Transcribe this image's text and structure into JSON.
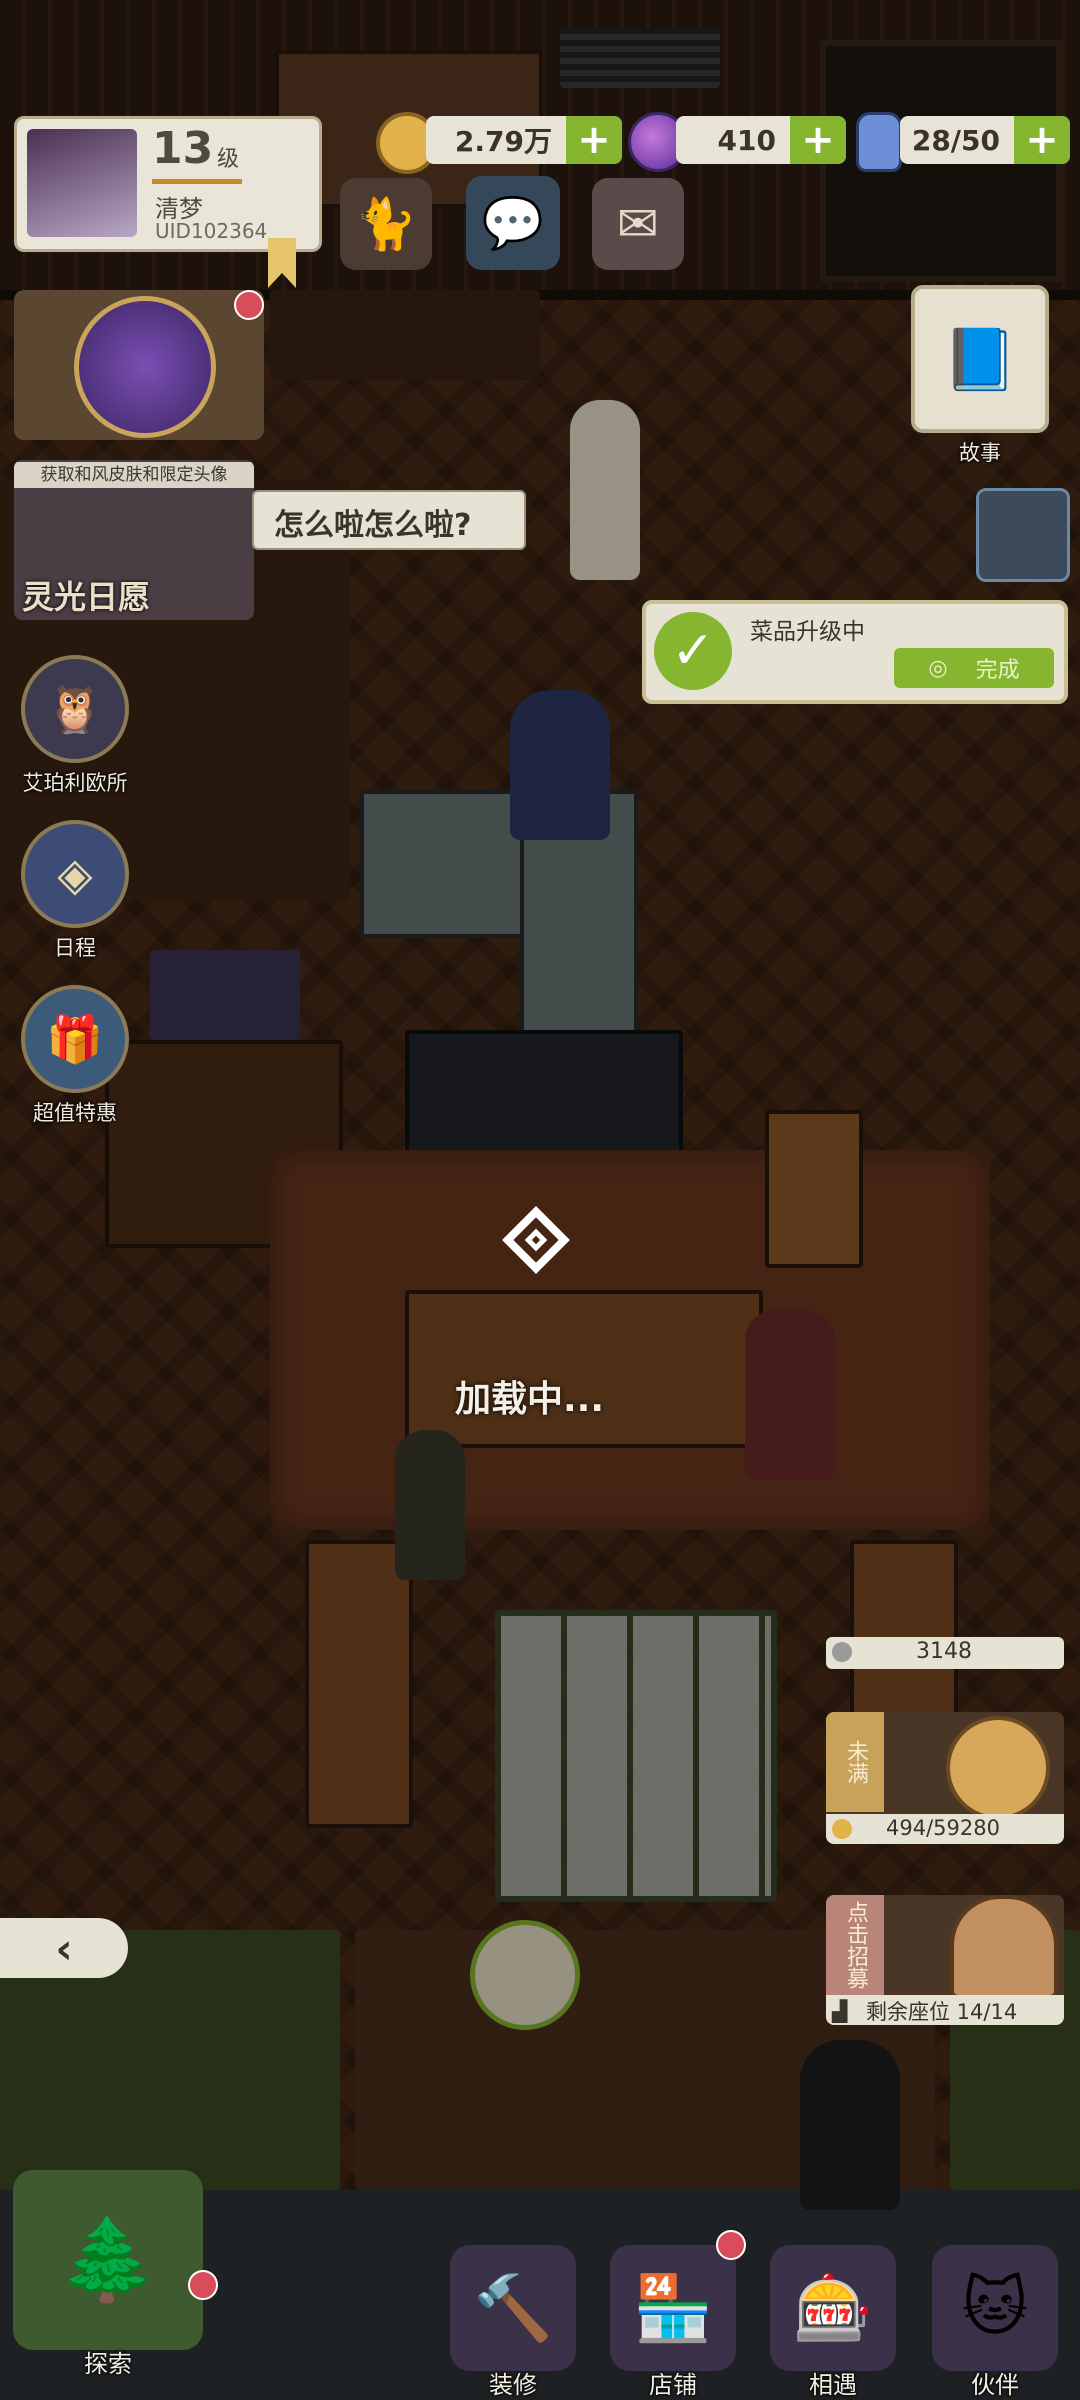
{
  "player": {
    "level_num": "13",
    "level_suffix": "级",
    "name": "清梦",
    "uid": "UID102364"
  },
  "resources": {
    "coins": "2.79万",
    "gems": "410",
    "stamina": "28/50"
  },
  "promo": {
    "banner_text": "获取和风皮肤和限定头像",
    "banner_title": "灵光日愿"
  },
  "speech": {
    "text": "怎么啦怎么啦?"
  },
  "side_menu": {
    "office": "艾珀利欧所",
    "schedule": "日程",
    "deals": "超值特惠",
    "story": "故事"
  },
  "task": {
    "title": "菜品升级中",
    "button": "完成"
  },
  "loading": {
    "text": "加载中..."
  },
  "stats": {
    "popularity": "3148",
    "unfilled_tag": "未满",
    "progress": "494/59280",
    "recruit_tag": "点击招募",
    "seats": "剩余座位 14/14"
  },
  "bottom_nav": {
    "explore": "探索",
    "renovate": "装修",
    "shop": "店铺",
    "meet": "相遇",
    "partner": "伙伴"
  },
  "colors": {
    "accent_green": "#86b52f",
    "badge_red": "#d94c5b",
    "panel_cream": "#e7e3d6"
  }
}
